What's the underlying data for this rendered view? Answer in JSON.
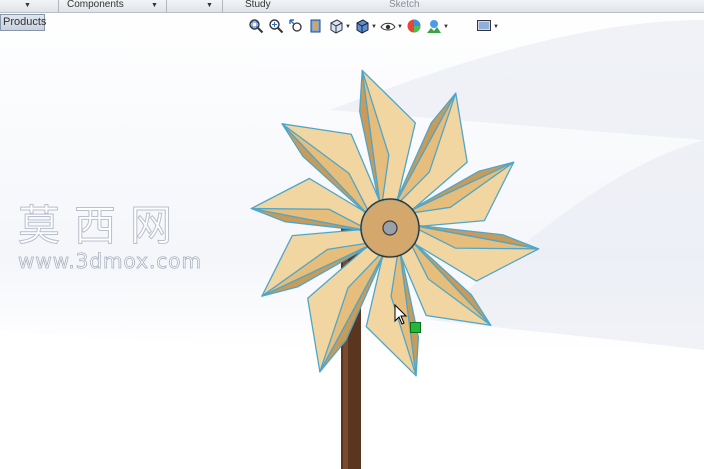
{
  "command_manager": {
    "tabs": [
      {
        "label": "",
        "has_dropdown": true
      },
      {
        "label": "Components",
        "has_dropdown": true
      },
      {
        "label": "",
        "has_dropdown": true
      },
      {
        "label": "Study",
        "has_dropdown": false
      },
      {
        "label": "Sketch",
        "has_dropdown": false,
        "disabled": true
      }
    ]
  },
  "feature_manager": {
    "products_tab": "Products"
  },
  "heads_up_toolbar": {
    "tools": [
      {
        "icon": "zoom-to-fit-icon"
      },
      {
        "icon": "zoom-to-area-icon"
      },
      {
        "icon": "previous-view-icon"
      },
      {
        "icon": "section-view-icon"
      },
      {
        "icon": "view-orientation-icon",
        "has_dropdown": true
      },
      {
        "icon": "display-style-icon",
        "has_dropdown": true
      },
      {
        "icon": "hide-show-items-icon",
        "has_dropdown": true
      },
      {
        "icon": "edit-appearance-icon"
      },
      {
        "icon": "apply-scene-icon",
        "has_dropdown": true
      },
      {
        "icon": "view-settings-icon",
        "has_dropdown": true
      }
    ]
  },
  "model": {
    "name": "pinwheel",
    "blade_count": 10,
    "colors": {
      "blade_light": "#f1d6a2",
      "blade_mid": "#e6bd7a",
      "blade_dark": "#c99a58",
      "edge_highlight": "#4fa6c8",
      "hub": "#d4a86c",
      "hub_ring": "#3b3128",
      "pin": "#9aa0a8",
      "stick": "#5a3520"
    }
  },
  "watermark": {
    "chinese": "莫西网",
    "url": "www.3dmox.com"
  },
  "selection": {
    "handle_color": "#22b83a"
  }
}
